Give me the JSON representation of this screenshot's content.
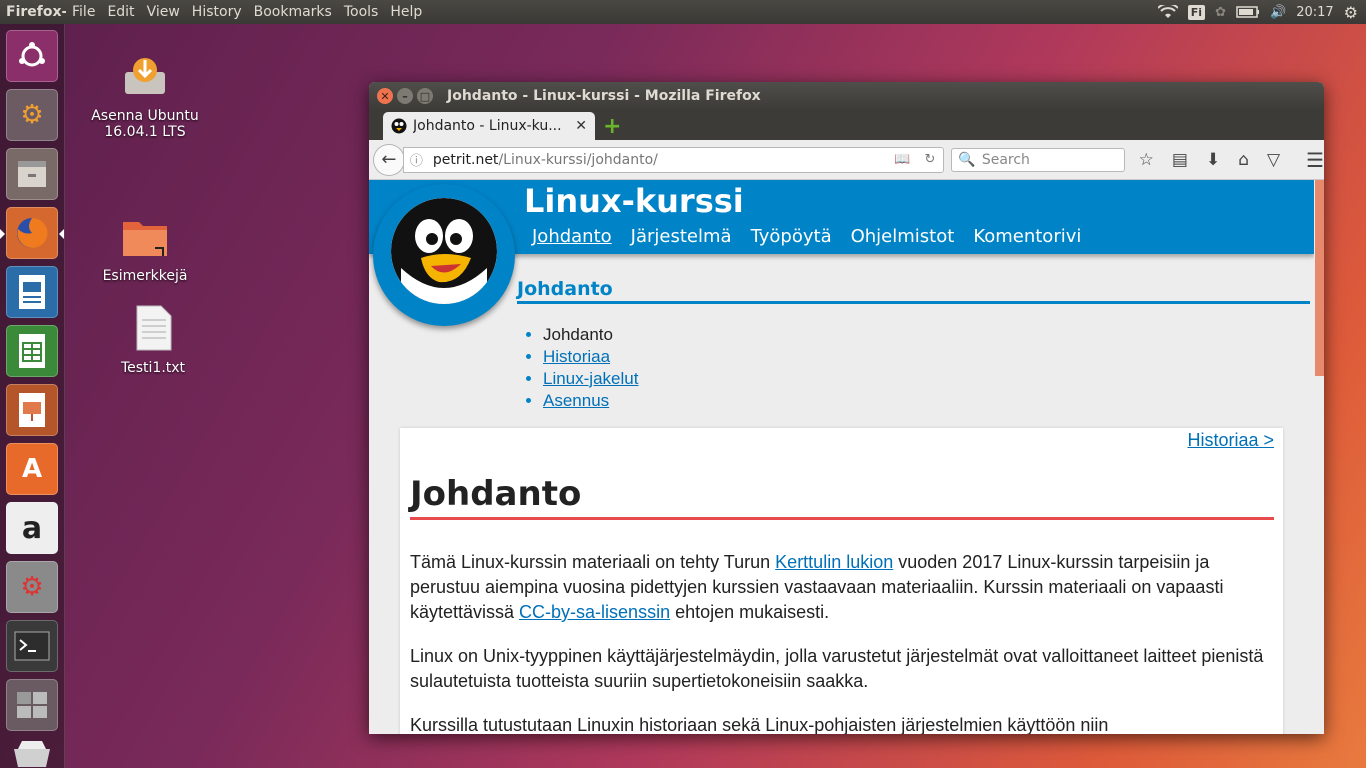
{
  "top_panel": {
    "app_name": "Firefox-s",
    "menu": [
      "File",
      "Edit",
      "View",
      "History",
      "Bookmarks",
      "Tools",
      "Help"
    ],
    "keyboard_layout": "Fi",
    "clock": "20:17"
  },
  "launcher": {
    "items": [
      "dash-home",
      "install-ubuntu",
      "files",
      "firefox",
      "libreoffice-writer",
      "libreoffice-calc",
      "libreoffice-impress",
      "software-center",
      "amazon",
      "system-settings",
      "terminal",
      "workspace-switcher",
      "trash"
    ]
  },
  "desktop": {
    "icons": [
      {
        "label_line1": "Asenna Ubuntu",
        "label_line2": "16.04.1 LTS"
      },
      {
        "label_line1": "Esimerkkejä"
      },
      {
        "label_line1": "Testi1.txt"
      }
    ]
  },
  "window": {
    "title": "Johdanto - Linux-kurssi - Mozilla Firefox",
    "tab_label": "Johdanto - Linux-ku...",
    "url_domain": "petrit.net",
    "url_path": "/Linux-kurssi/johdanto/",
    "search_placeholder": "Search"
  },
  "page": {
    "site_title": "Linux-kurssi",
    "nav": [
      "Johdanto",
      "Järjestelmä",
      "Työpöytä",
      "Ohjelmistot",
      "Komentorivi"
    ],
    "section_heading": "Johdanto",
    "toc": [
      "Johdanto",
      "Historiaa",
      "Linux-jakelut",
      "Asennus"
    ],
    "next_link": "Historiaa >",
    "article_title": "Johdanto",
    "p1_a": "Tämä Linux-kurssin materiaali on tehty Turun ",
    "p1_link1": "Kerttulin lukion",
    "p1_b": " vuoden 2017 Linux-kurssin tarpeisiin ja perustuu aiempina vuosina pidettyjen kurssien vastaavaan materiaaliin. Kurssin materiaali on vapaasti käytettävissä ",
    "p1_link2": "CC-by-sa-lisenssin",
    "p1_c": " ehtojen mukaisesti.",
    "p2": "Linux on Unix-tyyppinen käyttäjärjestelmäydin, jolla varustetut järjestelmät ovat valloittaneet laitteet pienistä sulautetuista tuotteista suuriin supertietokoneisiin saakka.",
    "p3": "Kurssilla tutustutaan Linuxin historiaan sekä Linux-pohjaisten järjestelmien käyttöön niin"
  }
}
